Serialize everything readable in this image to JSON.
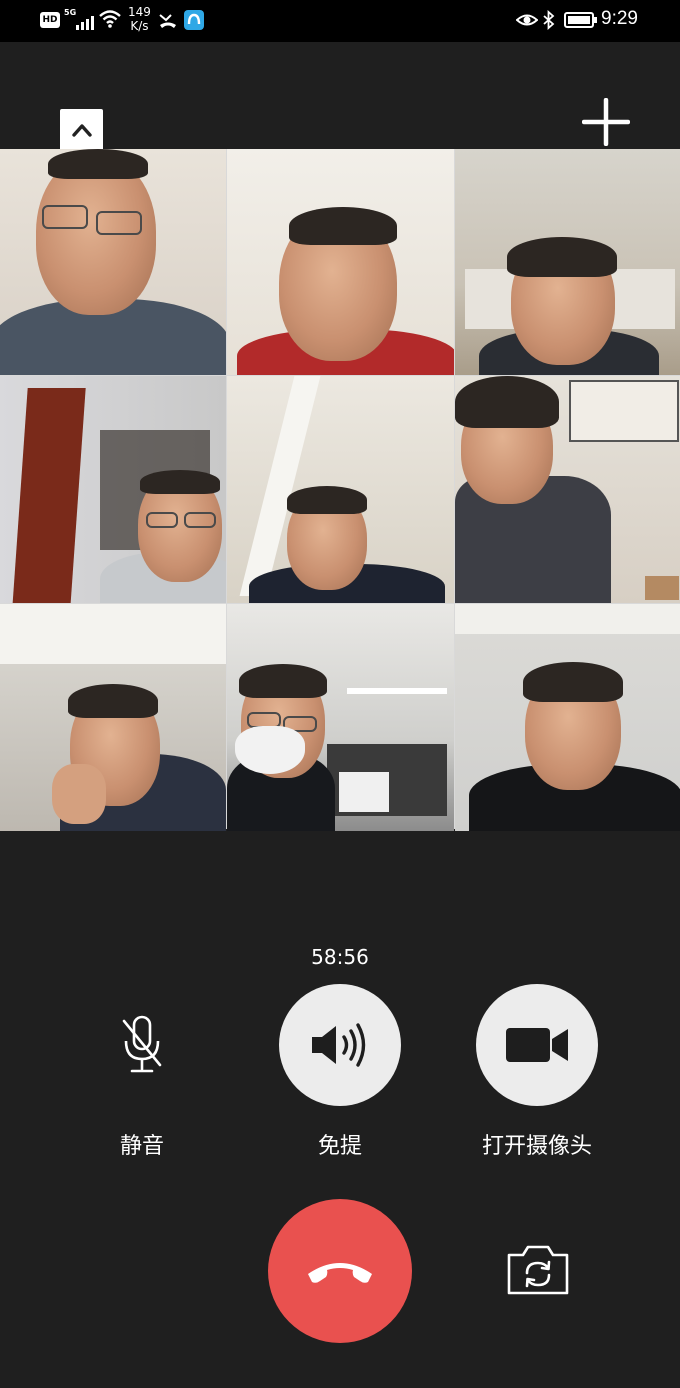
{
  "status_bar": {
    "hd_label": "HD",
    "network": "5G",
    "net_speed_value": "149",
    "net_speed_unit": "K/s",
    "time": "9:29",
    "icons": [
      "hd-icon",
      "signal-icon",
      "wifi-icon",
      "missed-call-icon",
      "app-icon",
      "eye-icon",
      "bluetooth-icon",
      "battery-icon"
    ]
  },
  "call": {
    "duration": "58:56",
    "participant_count": 9,
    "controls": {
      "mute_label": "静音",
      "speaker_label": "免提",
      "camera_label": "打开摄像头"
    }
  },
  "colors": {
    "background": "#1f1f1f",
    "hangup": "#e9514f",
    "button_light": "#ececec"
  }
}
